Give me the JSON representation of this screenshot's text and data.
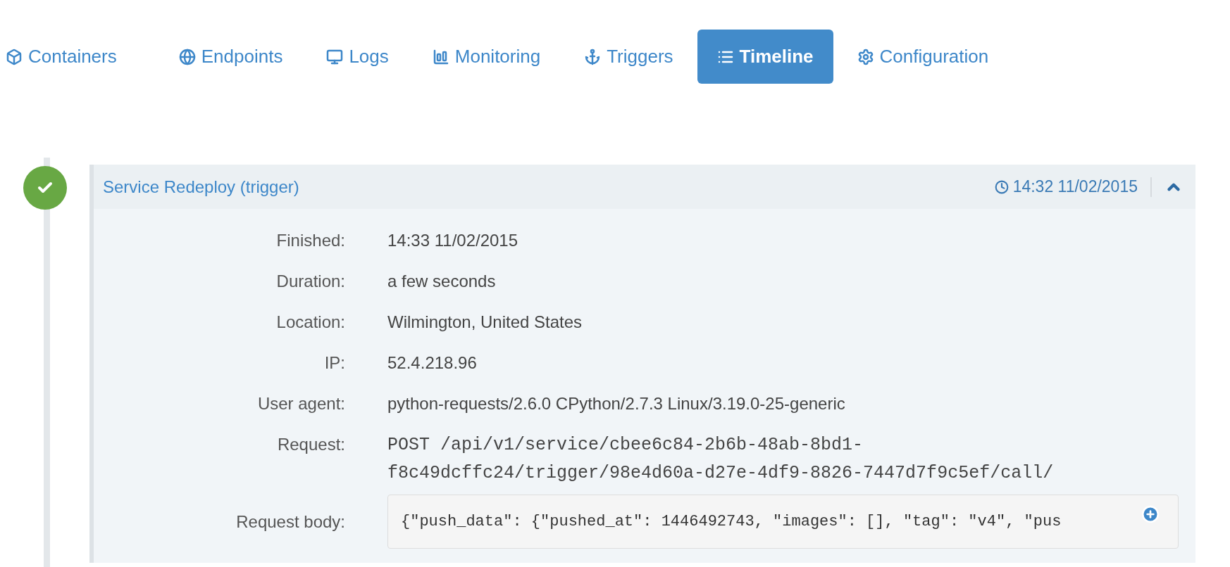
{
  "tabs": [
    {
      "label": "Containers",
      "selected": false
    },
    {
      "label": "Endpoints",
      "selected": false
    },
    {
      "label": "Logs",
      "selected": false
    },
    {
      "label": "Monitoring",
      "selected": false
    },
    {
      "label": "Triggers",
      "selected": false
    },
    {
      "label": "Timeline",
      "selected": true
    },
    {
      "label": "Configuration",
      "selected": false
    }
  ],
  "event": {
    "kind": "success",
    "title": "Service Redeploy (trigger)",
    "time": "14:32 11/02/2015",
    "expanded": true,
    "fields": [
      {
        "kind": "text",
        "label": "Finished:",
        "value": "14:33 11/02/2015"
      },
      {
        "kind": "text",
        "label": "Duration:",
        "value": "a few seconds"
      },
      {
        "kind": "text",
        "label": "Location:",
        "value": "Wilmington, United States"
      },
      {
        "kind": "text",
        "label": "IP:",
        "value": "52.4.218.96"
      },
      {
        "kind": "text",
        "label": "User agent:",
        "value": "python-requests/2.6.0 CPython/2.7.3 Linux/3.19.0-25-generic"
      },
      {
        "kind": "mono",
        "label": "Request:",
        "value": "POST /api/v1/service/cbee6c84-2b6b-48ab-8bd1-f8c49dcffc24/trigger/98e4d60a-d27e-4df9-8826-7447d7f9c5ef/call/"
      },
      {
        "kind": "code",
        "label": "Request body:",
        "value": "{\"push_data\": {\"pushed_at\": 1446492743, \"images\": [], \"tag\": \"v4\", \"pus"
      }
    ]
  }
}
